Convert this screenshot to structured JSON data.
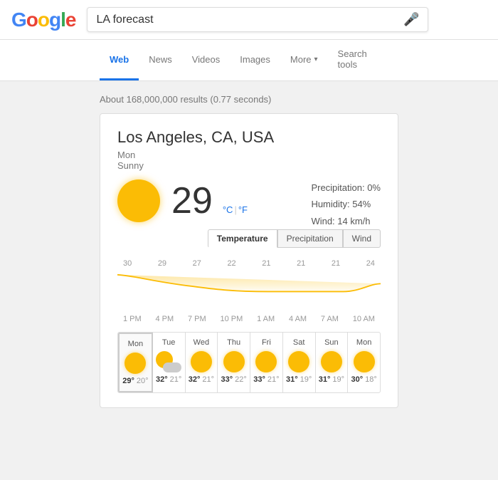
{
  "header": {
    "logo": "Google",
    "search_value": "LA forecast",
    "mic_label": "🎤"
  },
  "nav": {
    "items": [
      {
        "id": "web",
        "label": "Web",
        "active": true
      },
      {
        "id": "news",
        "label": "News",
        "active": false
      },
      {
        "id": "videos",
        "label": "Videos",
        "active": false
      },
      {
        "id": "images",
        "label": "Images",
        "active": false
      },
      {
        "id": "more",
        "label": "More",
        "has_arrow": true,
        "active": false
      },
      {
        "id": "search-tools",
        "label": "Search tools",
        "active": false
      }
    ]
  },
  "results": {
    "count_text": "About 168,000,000 results (0.77 seconds)"
  },
  "weather": {
    "city": "Los Angeles, CA, USA",
    "day": "Mon",
    "condition": "Sunny",
    "temperature": "29",
    "unit_c": "°C",
    "unit_sep": " | ",
    "unit_f": "°F",
    "precipitation": "Precipitation: 0%",
    "humidity": "Humidity: 54%",
    "wind": "Wind: 14 km/h",
    "chart_tabs": [
      "Temperature",
      "Precipitation",
      "Wind"
    ],
    "chart_temps": [
      "30",
      "29",
      "27",
      "22",
      "21",
      "21",
      "21",
      "24"
    ],
    "chart_times": [
      "1 PM",
      "4 PM",
      "7 PM",
      "10 PM",
      "1 AM",
      "4 AM",
      "7 AM",
      "10 AM"
    ],
    "forecast": [
      {
        "day": "Mon",
        "icon": "sun",
        "hi": "29°",
        "lo": "20°",
        "selected": true
      },
      {
        "day": "Tue",
        "icon": "partly",
        "hi": "32°",
        "lo": "21°",
        "selected": false
      },
      {
        "day": "Wed",
        "icon": "sun",
        "hi": "32°",
        "lo": "21°",
        "selected": false
      },
      {
        "day": "Thu",
        "icon": "sun",
        "hi": "33°",
        "lo": "22°",
        "selected": false
      },
      {
        "day": "Fri",
        "icon": "sun",
        "hi": "33°",
        "lo": "21°",
        "selected": false
      },
      {
        "day": "Sat",
        "icon": "sun",
        "hi": "31°",
        "lo": "19°",
        "selected": false
      },
      {
        "day": "Sun",
        "icon": "sun",
        "hi": "31°",
        "lo": "19°",
        "selected": false
      },
      {
        "day": "Mon",
        "icon": "sun",
        "hi": "30°",
        "lo": "18°",
        "selected": false
      }
    ]
  }
}
